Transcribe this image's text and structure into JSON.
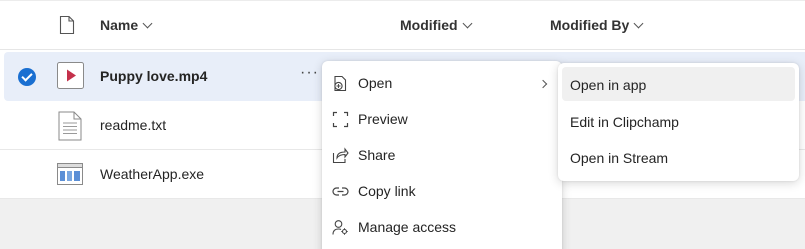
{
  "header": {
    "name_label": "Name",
    "modified_label": "Modified",
    "modified_by_label": "Modified By"
  },
  "files": [
    {
      "name": "Puppy love.mp4",
      "icon": "video-file-icon",
      "selected": true
    },
    {
      "name": "readme.txt",
      "icon": "text-file-icon",
      "selected": false
    },
    {
      "name": "WeatherApp.exe",
      "icon": "app-file-icon",
      "selected": false
    }
  ],
  "more_actions": "···",
  "context_menu": {
    "items": [
      {
        "label": "Open",
        "icon": "open-with-icon",
        "has_submenu": true
      },
      {
        "label": "Preview",
        "icon": "preview-icon"
      },
      {
        "label": "Share",
        "icon": "share-icon"
      },
      {
        "label": "Copy link",
        "icon": "link-icon"
      },
      {
        "label": "Manage access",
        "icon": "manage-access-icon"
      }
    ]
  },
  "submenu": {
    "items": [
      {
        "label": "Open in app",
        "highlighted": true
      },
      {
        "label": "Edit in Clipchamp"
      },
      {
        "label": "Open in Stream"
      }
    ]
  },
  "colors": {
    "selection_bg": "#e8eef9",
    "check_blue": "#1a6fd1",
    "video_red": "#c4314b"
  }
}
